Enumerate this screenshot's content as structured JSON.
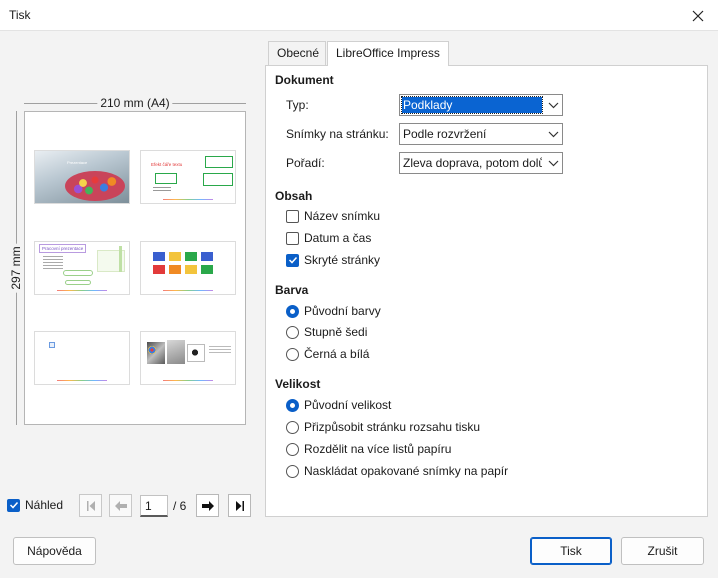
{
  "window": {
    "title": "Tisk"
  },
  "preview": {
    "width_label": "210 mm (A4)",
    "height_label": "297 mm",
    "thumbs": [
      {
        "title": "Prezentace"
      },
      {
        "title": "Efekt čáře textu"
      },
      {
        "title": "Pracovní prezentace"
      },
      {
        "title": ""
      },
      {
        "title": ""
      },
      {
        "title": ""
      }
    ]
  },
  "nav": {
    "preview_label": "Náhled",
    "preview_checked": true,
    "page": "1",
    "total": "/ 6"
  },
  "tabs": [
    {
      "label": "Obecné",
      "active": false
    },
    {
      "label": "LibreOffice Impress",
      "active": true
    }
  ],
  "document": {
    "heading": "Dokument",
    "type_label": "Typ:",
    "type_value": "Podklady",
    "slides_label": "Snímky na stránku:",
    "slides_value": "Podle rozvržení",
    "order_label": "Pořadí:",
    "order_value": "Zleva doprava, potom dolů"
  },
  "content": {
    "heading": "Obsah",
    "options": [
      {
        "label": "Název snímku",
        "checked": false
      },
      {
        "label": "Datum a čas",
        "checked": false
      },
      {
        "label": "Skryté stránky",
        "checked": true
      }
    ]
  },
  "color": {
    "heading": "Barva",
    "options": [
      {
        "label": "Původní barvy",
        "checked": true
      },
      {
        "label": "Stupně šedi",
        "checked": false
      },
      {
        "label": "Černá a bílá",
        "checked": false
      }
    ]
  },
  "size": {
    "heading": "Velikost",
    "options": [
      {
        "label": "Původní velikost",
        "checked": true
      },
      {
        "label": "Přizpůsobit stránku rozsahu tisku",
        "checked": false
      },
      {
        "label": "Rozdělit na více listů papíru",
        "checked": false
      },
      {
        "label": "Naskládat opakované snímky na papír",
        "checked": false
      }
    ]
  },
  "buttons": {
    "help": "Nápověda",
    "print": "Tisk",
    "cancel": "Zrušit"
  },
  "colors": {
    "accent": "#0a5fc8",
    "selection": "#0a64d2"
  }
}
